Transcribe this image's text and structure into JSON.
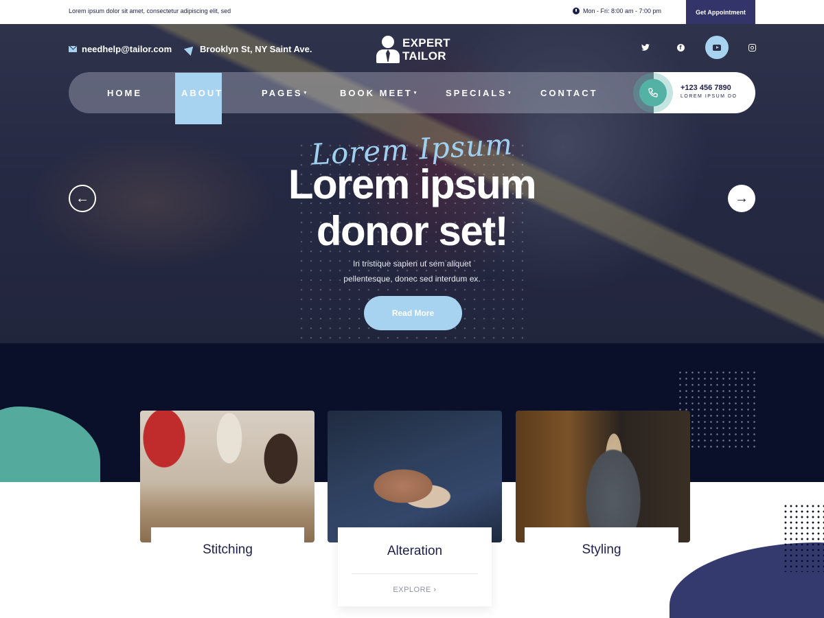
{
  "topbar": {
    "tagline": "Lorem ipsum dolor sit amet, consectetur adipiscing elit, sed",
    "hours": "Mon - Fri: 8:00 am - 7:00 pm",
    "appointment_label": "Get Appointment"
  },
  "header": {
    "email": "needhelp@tailor.com",
    "address": "Brooklyn St, NY Saint Ave.",
    "logo_line1": "EXPERT",
    "logo_line2": "TAILOR",
    "social": [
      "twitter",
      "facebook",
      "youtube",
      "instagram"
    ],
    "social_active": "youtube"
  },
  "nav": {
    "items": [
      {
        "label": "HOME",
        "has_dropdown": false
      },
      {
        "label": "ABOUT",
        "has_dropdown": false,
        "active": true
      },
      {
        "label": "PAGES",
        "has_dropdown": true
      },
      {
        "label": "BOOK MEET",
        "has_dropdown": true
      },
      {
        "label": "SPECIALS",
        "has_dropdown": true
      },
      {
        "label": "CONTACT",
        "has_dropdown": false
      }
    ],
    "caret": "▾",
    "phone": "+123 456 7890",
    "phone_sub": "LOREM IPSUM DO"
  },
  "hero": {
    "script": "Lorem Ipsum",
    "headline_line1": "Lorem ipsum",
    "headline_line2": "donor set!",
    "sub_line1": "In tristique sapien ut sem aliquet",
    "sub_line2": "pellentesque, donec sed interdum ex.",
    "cta": "Read More",
    "prev_icon": "←",
    "next_icon": "→"
  },
  "services": {
    "cards": [
      {
        "title": "Stitching",
        "image": "stitching-photo"
      },
      {
        "title": "Alteration",
        "image": "alteration-photo",
        "action": "EXPLORE ›"
      },
      {
        "title": "Styling",
        "image": "styling-photo"
      }
    ]
  },
  "colors": {
    "accent": "#a7d3f0",
    "navy": "#33346a",
    "dark": "#0a1029",
    "teal": "#54b2a5"
  }
}
